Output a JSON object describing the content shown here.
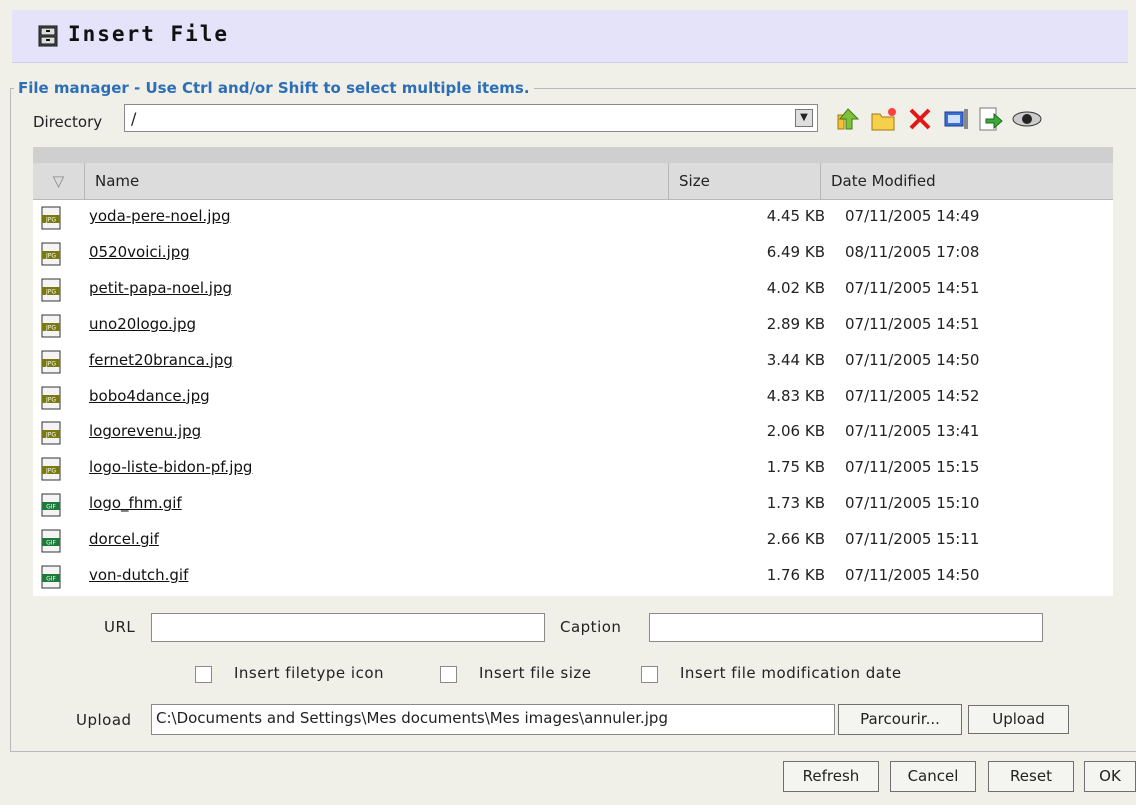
{
  "window": {
    "title": "Insert File",
    "icon": "file-cabinet-icon"
  },
  "file_manager": {
    "legend": "File manager - Use Ctrl and/or Shift to select multiple items.",
    "directory_label": "Directory",
    "directory_value": "/",
    "toolbar": [
      {
        "name": "up-directory-icon"
      },
      {
        "name": "new-folder-icon"
      },
      {
        "name": "delete-icon"
      },
      {
        "name": "rename-icon"
      },
      {
        "name": "move-icon"
      },
      {
        "name": "preview-icon"
      }
    ]
  },
  "table": {
    "columns": [
      "Name",
      "Size",
      "Date Modified"
    ],
    "files": [
      {
        "type": "JPG",
        "name": "yoda-pere-noel.jpg",
        "size": "4.45 KB",
        "date": "07/11/2005 14:49"
      },
      {
        "type": "JPG",
        "name": "0520voici.jpg",
        "size": "6.49 KB",
        "date": "08/11/2005 17:08"
      },
      {
        "type": "JPG",
        "name": "petit-papa-noel.jpg",
        "size": "4.02 KB",
        "date": "07/11/2005 14:51"
      },
      {
        "type": "JPG",
        "name": "uno20logo.jpg",
        "size": "2.89 KB",
        "date": "07/11/2005 14:51"
      },
      {
        "type": "JPG",
        "name": "fernet20branca.jpg",
        "size": "3.44 KB",
        "date": "07/11/2005 14:50"
      },
      {
        "type": "JPG",
        "name": "bobo4dance.jpg",
        "size": "4.83 KB",
        "date": "07/11/2005 14:52"
      },
      {
        "type": "JPG",
        "name": "logorevenu.jpg",
        "size": "2.06 KB",
        "date": "07/11/2005 13:41"
      },
      {
        "type": "JPG",
        "name": "logo-liste-bidon-pf.jpg",
        "size": "1.75 KB",
        "date": "07/11/2005 15:15"
      },
      {
        "type": "GIF",
        "name": "logo_fhm.gif",
        "size": "1.73 KB",
        "date": "07/11/2005 15:10"
      },
      {
        "type": "GIF",
        "name": "dorcel.gif",
        "size": "2.66 KB",
        "date": "07/11/2005 15:11"
      },
      {
        "type": "GIF",
        "name": "von-dutch.gif",
        "size": "1.76 KB",
        "date": "07/11/2005 14:50"
      }
    ]
  },
  "form": {
    "url_label": "URL",
    "url_value": "",
    "caption_label": "Caption",
    "caption_value": "",
    "checkboxes": [
      {
        "label": "Insert filetype icon",
        "checked": false
      },
      {
        "label": "Insert file size",
        "checked": false
      },
      {
        "label": "Insert file modification date",
        "checked": false
      }
    ],
    "upload_label": "Upload",
    "upload_path": "C:\\Documents and Settings\\Mes documents\\Mes images\\annuler.jpg",
    "browse_label": "Parcourir...",
    "upload_button": "Upload"
  },
  "footer": {
    "refresh": "Refresh",
    "cancel": "Cancel",
    "reset": "Reset",
    "ok": "OK"
  }
}
